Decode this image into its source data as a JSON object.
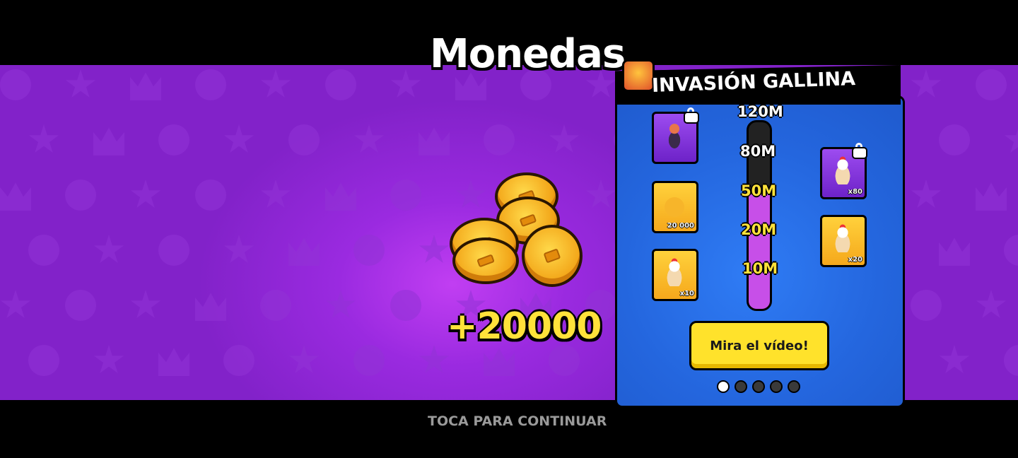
{
  "screen": {
    "title": "Monedas",
    "reward_text": "+20000",
    "continue_prompt": "TOCA PARA CONTINUAR"
  },
  "event": {
    "title": "INVASIÓN GALLINA",
    "milestones": [
      {
        "label": "120M",
        "reached": false
      },
      {
        "label": "80M",
        "reached": false
      },
      {
        "label": "50M",
        "reached": true
      },
      {
        "label": "20M",
        "reached": true
      },
      {
        "label": "10M",
        "reached": true
      }
    ],
    "progress_fraction": 0.62,
    "rewards_left": [
      {
        "name": "brawler-skin-reward",
        "quantity": "",
        "locked": true,
        "card_color": "purple"
      },
      {
        "name": "coins-reward",
        "quantity": "20 000",
        "locked": false,
        "card_color": "yellow"
      },
      {
        "name": "chicken-pins-reward",
        "quantity": "x10",
        "locked": false,
        "card_color": "yellow"
      }
    ],
    "rewards_right": [
      {
        "name": "chicken-reward-80",
        "quantity": "x80",
        "locked": true,
        "card_color": "purple"
      },
      {
        "name": "chicken-reward-20",
        "quantity": "x20",
        "locked": false,
        "card_color": "yellow"
      }
    ],
    "video_button_label": "Mira el vídeo!",
    "page_dots": 5,
    "active_dot": 0
  },
  "colors": {
    "background_purple": "#8222c9",
    "panel_blue": "#2668e6",
    "accent_yellow": "#ffe22b",
    "progress_fill": "#c74fe8"
  }
}
